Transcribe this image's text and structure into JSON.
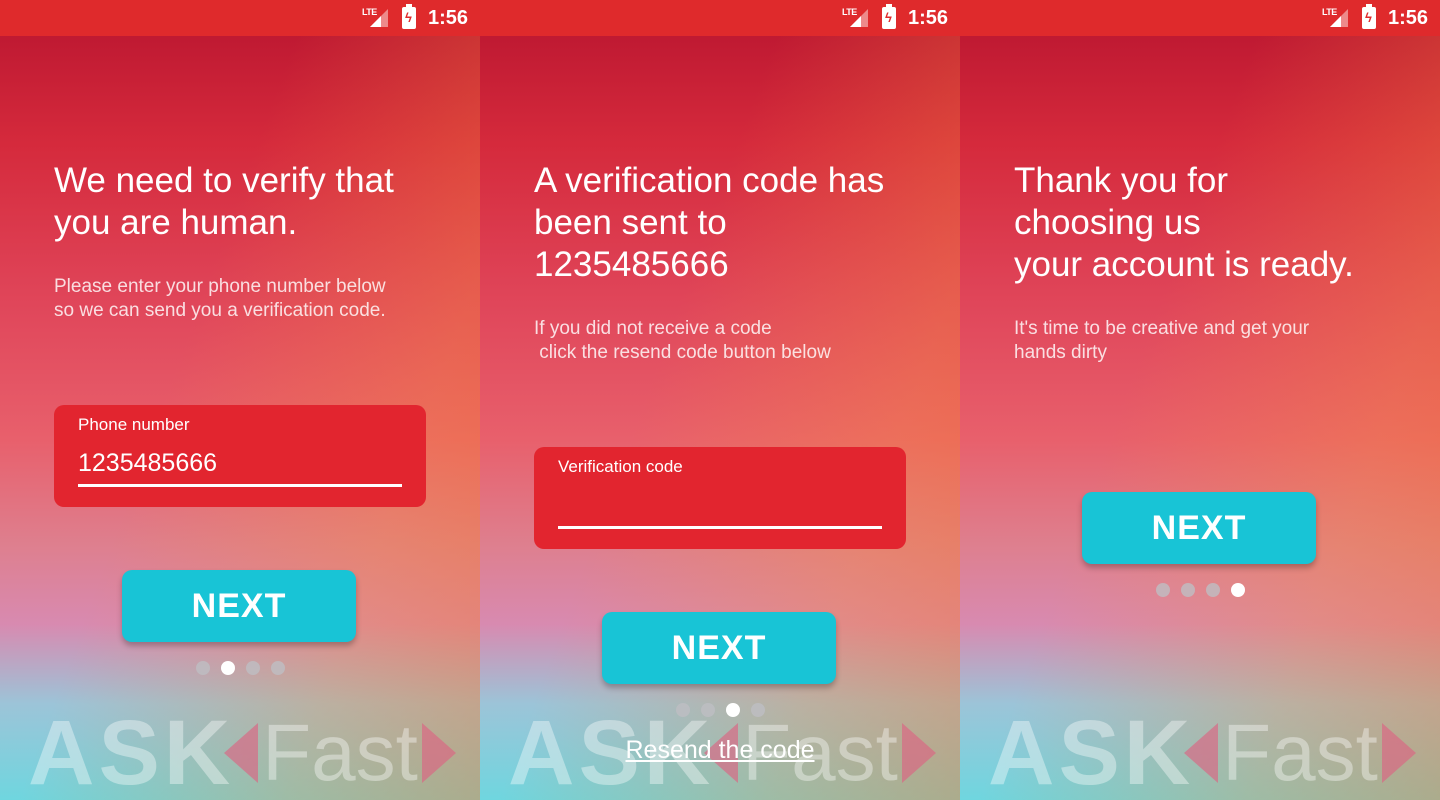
{
  "status_bar": {
    "network": "LTE",
    "time": "1:56"
  },
  "screens": [
    {
      "title": "We need to verify that\nyou are human.",
      "subtitle": "Please enter your phone number below\nso we can send you a verification code.",
      "field": {
        "label": "Phone number",
        "value": "1235485666"
      },
      "button_label": "NEXT",
      "page_indicator": {
        "total": 4,
        "active": 2
      }
    },
    {
      "title": "A verification code has\nbeen sent to\n1235485666",
      "subtitle": "If you did not receive a code\n click the resend code button below",
      "field": {
        "label": "Verification code",
        "value": ""
      },
      "button_label": "NEXT",
      "page_indicator": {
        "total": 4,
        "active": 3
      },
      "resend_label": "Resend the code"
    },
    {
      "title": "Thank you for\nchoosing us\nyour account is ready.",
      "subtitle": "It's time to be creative and get your\nhands dirty",
      "button_label": "NEXT",
      "page_indicator": {
        "total": 4,
        "active": 4
      }
    }
  ],
  "logo": {
    "part1": "ASK",
    "part2": "Fast"
  },
  "colors": {
    "status_bar": "#df2a2c",
    "field_bg": "#e2252f",
    "button_bg": "#18c4d6",
    "dot_active": "#ffffff"
  },
  "icons": [
    "lte-signal-icon",
    "battery-charging-icon",
    "chevron-left-icon",
    "chevron-right-icon"
  ]
}
